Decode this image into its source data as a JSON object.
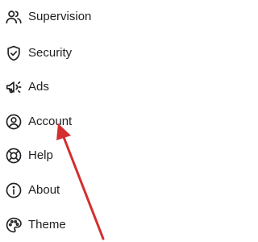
{
  "menu": {
    "items": [
      {
        "label": "Supervision",
        "icon": "supervision-icon"
      },
      {
        "label": "Security",
        "icon": "shield-icon"
      },
      {
        "label": "Ads",
        "icon": "megaphone-icon"
      },
      {
        "label": "Account",
        "icon": "account-icon"
      },
      {
        "label": "Help",
        "icon": "lifebuoy-icon"
      },
      {
        "label": "About",
        "icon": "info-icon"
      },
      {
        "label": "Theme",
        "icon": "palette-icon"
      }
    ]
  },
  "annotation": {
    "arrow_color": "#d32f2f",
    "points_to": "Account"
  }
}
